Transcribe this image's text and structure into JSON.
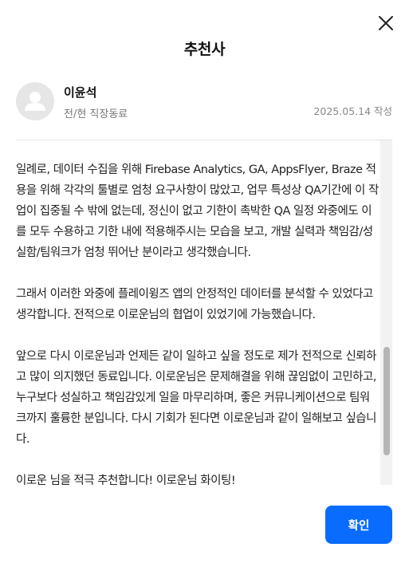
{
  "dialog": {
    "title": "추천사",
    "close_icon": "close-icon"
  },
  "recommender": {
    "name": "이윤석",
    "relation": "전/현 직장동료",
    "date": "2025.05.14 작성",
    "avatar_icon": "user-avatar-icon"
  },
  "content": {
    "paragraphs": [
      "일례로, 데이터 수집을 위해 Firebase Analytics, GA, AppsFlyer, Braze 적용을 위해 각각의 툴별로 엄청 요구사항이 많았고, 업무 특성상 QA기간에 이 작업이 집중될 수 밖에 없는데, 정신이 없고 기한이 촉박한 QA 일정 와중에도 이를 모두 수용하고 기한 내에 적용해주시는 모습을 보고, 개발 실력과 책임감/성실함/팀워크가 엄청 뛰어난 분이라고 생각했습니다.",
      "그래서 이러한 와중에 플레이윙즈 앱의 안정적인 데이터를 분석할 수 있었다고 생각합니다. 전적으로 이로운님의 협업이 있었기에 가능했습니다.",
      "앞으로 다시 이로운님과 언제든 같이 일하고 싶을 정도로 제가 전적으로 신뢰하고 많이 의지했던 동료입니다. 이로운님은 문제해결을 위해 끊임없이 고민하고, 누구보다 성실하고 책임감있게 일을 마무리하며, 좋은 커뮤니케이션으로 팀워크까지 훌륭한 분입니다. 다시 기회가 된다면 이로운님과 같이 일해보고 싶습니다.",
      "이로운 님을 적극 추천합니다! 이로운님 화이팅!"
    ]
  },
  "footer": {
    "confirm_label": "확인"
  },
  "colors": {
    "accent": "#0a6cff",
    "avatar_bg": "#e6e6e6",
    "muted_text": "#777777"
  }
}
